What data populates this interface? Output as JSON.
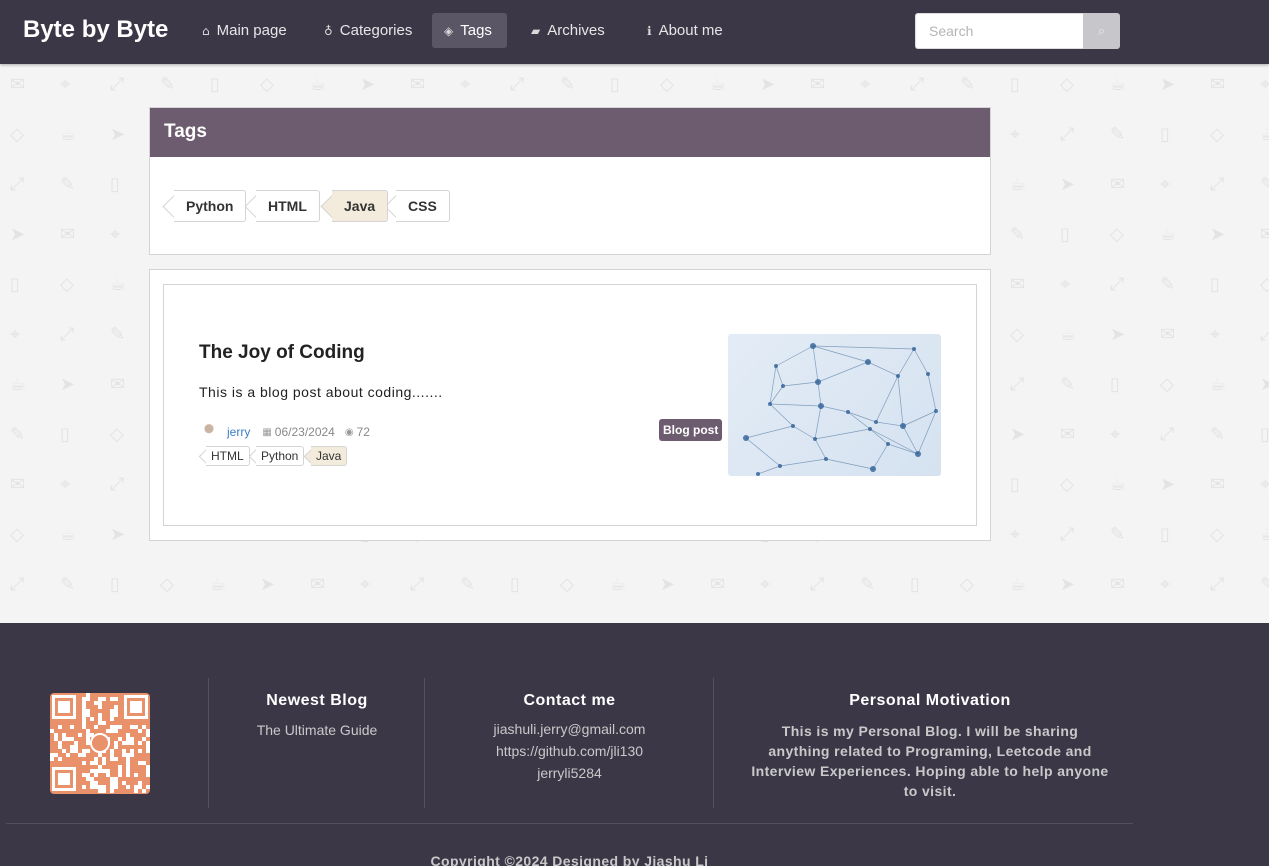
{
  "navbar": {
    "brand": "Byte by Byte",
    "items": [
      {
        "label": "Main page",
        "icon": "home-icon",
        "glyph": "⌂",
        "active": false
      },
      {
        "label": "Categories",
        "icon": "idea-icon",
        "glyph": "♁",
        "active": false
      },
      {
        "label": "Tags",
        "icon": "tags-icon",
        "glyph": "◈",
        "active": true
      },
      {
        "label": "Archives",
        "icon": "folder-icon",
        "glyph": "▰",
        "active": false
      },
      {
        "label": "About me",
        "icon": "info-icon",
        "glyph": "ℹ",
        "active": false
      }
    ],
    "search": {
      "placeholder": "Search",
      "button_icon": "search-icon"
    }
  },
  "tags_panel": {
    "title": "Tags",
    "tags": [
      {
        "label": "Python",
        "selected": false
      },
      {
        "label": "HTML",
        "selected": false
      },
      {
        "label": "Java",
        "selected": true
      },
      {
        "label": "CSS",
        "selected": false
      }
    ]
  },
  "post": {
    "title": "The Joy of Coding",
    "excerpt": "This is a blog post about coding.......",
    "author": "jerry",
    "date": "06/23/2024",
    "views": "72",
    "category": "Blog post",
    "tags": [
      {
        "label": "HTML",
        "selected": false
      },
      {
        "label": "Python",
        "selected": false
      },
      {
        "label": "Java",
        "selected": true
      }
    ]
  },
  "footer": {
    "newest_blog": {
      "heading": "Newest Blog",
      "links": [
        "The Ultimate Guide"
      ]
    },
    "contact": {
      "heading": "Contact me",
      "lines": [
        "jiashuli.jerry@gmail.com",
        "https://github.com/jli130",
        "jerryli5284"
      ]
    },
    "motivation": {
      "heading": "Personal Motivation",
      "text": "This is my Personal Blog. I will be sharing anything related to Programing, Leetcode and Interview Experiences. Hoping able to help anyone to visit."
    },
    "copyright": "Copyright ©2024 Designed by Jiashu Li"
  },
  "colors": {
    "navbar_bg": "#3b3747",
    "accent_purple": "#6d5c6f",
    "selected_tag_bg": "#f3ecdc",
    "author_link": "#3b80c4",
    "qr_orange": "#e8916a"
  }
}
